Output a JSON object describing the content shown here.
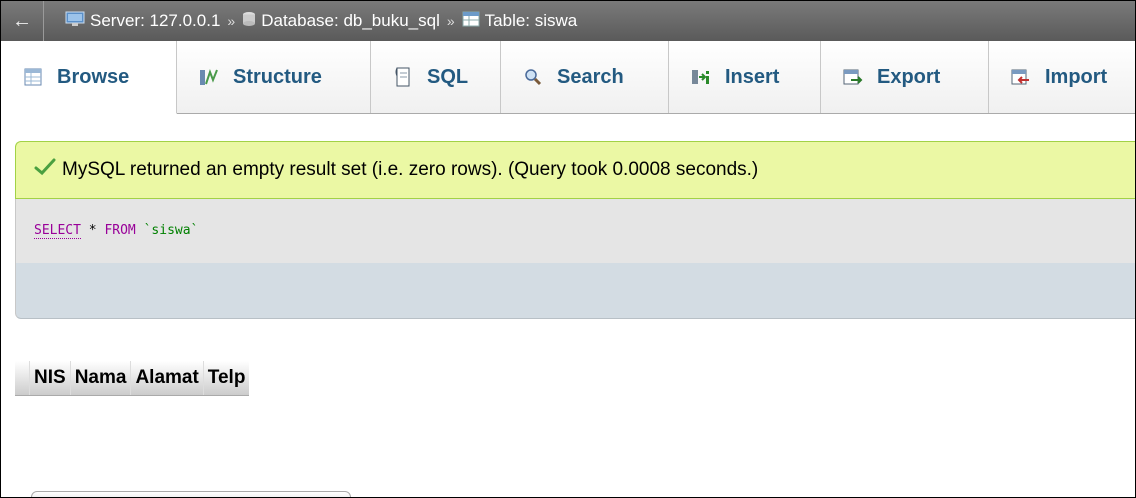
{
  "breadcrumb": {
    "back_label": "←",
    "server": "Server: 127.0.0.1",
    "database": "Database: db_buku_sql",
    "table": "Table: siswa",
    "separator": "»"
  },
  "tabs": [
    {
      "label": "Browse",
      "icon": "browse-icon",
      "active": true
    },
    {
      "label": "Structure",
      "icon": "structure-icon"
    },
    {
      "label": "SQL",
      "icon": "sql-icon"
    },
    {
      "label": "Search",
      "icon": "search-icon"
    },
    {
      "label": "Insert",
      "icon": "insert-icon"
    },
    {
      "label": "Export",
      "icon": "export-icon"
    },
    {
      "label": "Import",
      "icon": "import-icon"
    }
  ],
  "message": {
    "text": "MySQL returned an empty result set (i.e. zero rows). (Query took 0.0008 seconds.)",
    "icon": "check-icon",
    "bg_color": "#ebf8a4"
  },
  "sql": {
    "select": "SELECT",
    "star": "*",
    "from": "FROM",
    "table": "`siswa`"
  },
  "result_table": {
    "columns": [
      "NIS",
      "Nama",
      "Alamat",
      "Telp"
    ]
  },
  "colors": {
    "tab_text": "#235a81",
    "keyword": "#990099",
    "identifier": "#008000"
  }
}
